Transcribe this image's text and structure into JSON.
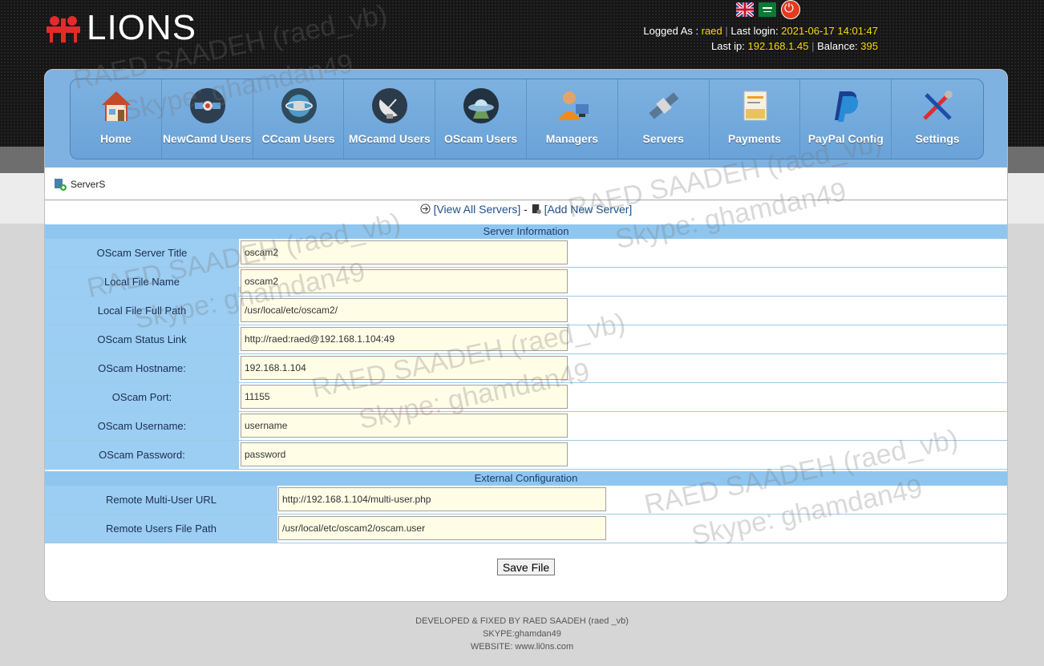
{
  "header": {
    "logo_text": "LIONS",
    "logged_as_label": "Logged As :",
    "username": "raed",
    "last_login_label": "Last login:",
    "last_login": "2021-06-17 14:01:47",
    "last_ip_label": "Last ip:",
    "last_ip": "192.168.1.45",
    "balance_label": "Balance:",
    "balance": "395"
  },
  "menu": [
    {
      "label": "Home",
      "icon": "house-icon"
    },
    {
      "label": "NewCamd Users",
      "icon": "satellite-icon"
    },
    {
      "label": "CCcam Users",
      "icon": "satellite-orbit-icon"
    },
    {
      "label": "MGcamd Users",
      "icon": "dish-icon"
    },
    {
      "label": "OScam Users",
      "icon": "ufo-icon"
    },
    {
      "label": "Managers",
      "icon": "manager-icon"
    },
    {
      "label": "Servers",
      "icon": "server-satellite-icon"
    },
    {
      "label": "Payments",
      "icon": "payment-card-icon"
    },
    {
      "label": "PayPal Config",
      "icon": "paypal-icon"
    },
    {
      "label": "Settings",
      "icon": "tools-icon"
    }
  ],
  "breadcrumb": "ServerS",
  "actions": {
    "view_all": "[View All Servers]",
    "separator": "-",
    "add_new": "[Add New Server]"
  },
  "server_info": {
    "heading": "Server Information",
    "fields": [
      {
        "label": "OScam Server Title",
        "value": "oscam2"
      },
      {
        "label": "Local File Name",
        "value": "oscam2"
      },
      {
        "label": "Local File Full Path",
        "value": "/usr/local/etc/oscam2/"
      },
      {
        "label": "OScam Status Link",
        "value": "http://raed:raed@192.168.1.104:49"
      },
      {
        "label": "OScam Hostname:",
        "value": "192.168.1.104"
      },
      {
        "label": "OScam Port:",
        "value": "11155"
      },
      {
        "label": "OScam Username:",
        "value": "username"
      },
      {
        "label": "OScam Password:",
        "value": "password"
      }
    ]
  },
  "external_config": {
    "heading": "External Configuration",
    "fields": [
      {
        "label": "Remote Multi-User URL",
        "value": "http://192.168.1.104/multi-user.php"
      },
      {
        "label": "Remote Users File Path",
        "value": "/usr/local/etc/oscam2/oscam.user"
      }
    ]
  },
  "save_label": "Save File",
  "footer": {
    "line1": "DEVELOPED & FIXED BY RAED SAADEH (raed _vb)",
    "line2": "SKYPE:ghamdan49",
    "line3": "WEBSITE: www.li0ns.com"
  },
  "watermark": {
    "line1": "RAED SAADEH (raed_vb)",
    "line2": "Skype: ghamdan49"
  },
  "colors": {
    "accent_yellow": "#f5d90a",
    "menu_blue": "#7fb2e0",
    "label_blue": "#9ccdf3",
    "input_bg": "#fffde6",
    "logo_red": "#e22b2b"
  }
}
